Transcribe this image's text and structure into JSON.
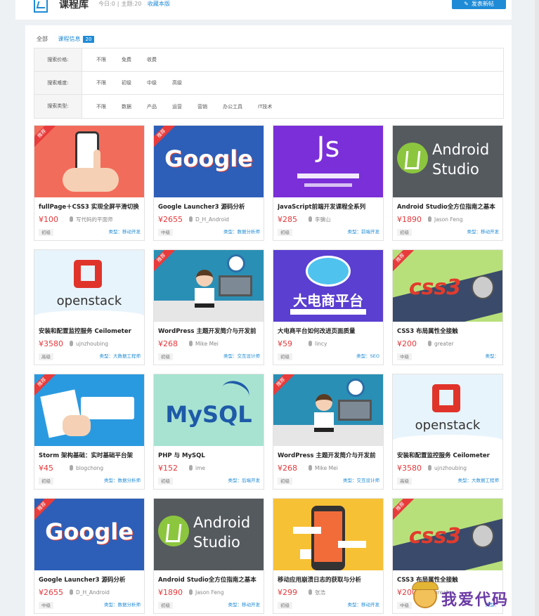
{
  "header": {
    "title": "课程库",
    "today_label": "今日:0",
    "topics_label": "主题:20",
    "bookmark": "收藏本版",
    "post_button": "发表新帖",
    "accent": "#1f8bd6"
  },
  "tabs": {
    "all": "全部",
    "course_info": "课程信息",
    "course_count": "20"
  },
  "filters": [
    {
      "label": "搜索价格:",
      "options": [
        "不限",
        "免费",
        "收费"
      ]
    },
    {
      "label": "搜索难度:",
      "options": [
        "不限",
        "初级",
        "中级",
        "高级"
      ]
    },
    {
      "label": "搜索类型:",
      "options": [
        "不限",
        "数据",
        "产品",
        "运营",
        "营销",
        "办公工具",
        "IT技术"
      ]
    }
  ],
  "cards": [
    {
      "title": "fullPage＋CSS3 实现全屏平滑切换",
      "price": "¥100",
      "author": "写代码的平面师",
      "level": "初级",
      "category": "类型：移动开发",
      "badge": "推荐",
      "thumb": "phone",
      "bg": "#f26c5b",
      "thumb_text": ""
    },
    {
      "title": "Google Launcher3 源码分析",
      "price": "¥2655",
      "author": "D_H_Android",
      "level": "中级",
      "category": "类型：数据分析师",
      "badge": "推荐",
      "thumb": "google",
      "bg": "#2d5fb8",
      "thumb_text": "Google"
    },
    {
      "title": "JavaScript前端开发课程全系列",
      "price": "¥285",
      "author": "李骥山",
      "level": "初级",
      "category": "类型：前端开发",
      "badge": "",
      "thumb": "js",
      "bg": "#7a2fd8",
      "thumb_text": "Js"
    },
    {
      "title": "Android Studio全方位指南之基本",
      "price": "¥1890",
      "author": "Jason Feng",
      "level": "初级",
      "category": "类型：移动开发",
      "badge": "",
      "thumb": "android",
      "bg": "#555a5f",
      "thumb_text": "Android Studio"
    },
    {
      "title": "安装和配置监控服务 Ceilometer",
      "price": "¥3580",
      "author": "ujnzhoubing",
      "level": "高级",
      "category": "类型：大数据工程师",
      "badge": "",
      "thumb": "openstack",
      "bg": "#e8f4fb",
      "thumb_text": "openstack"
    },
    {
      "title": "WordPress 主题开发简介与开发前",
      "price": "¥268",
      "author": "Mike Mei",
      "level": "初级",
      "category": "类型：交互设计师",
      "badge": "推荐",
      "thumb": "wordpress",
      "bg": "#2a8fb5",
      "thumb_text": ""
    },
    {
      "title": "大电商平台如何改进页面质量",
      "price": "¥59",
      "author": "lincy",
      "level": "初级",
      "category": "类型：SEO",
      "badge": "",
      "thumb": "ecommerce",
      "bg": "#5a3fd0",
      "thumb_text": "大电商平台"
    },
    {
      "title": "CSS3 布局属性全接触",
      "price": "¥200",
      "author": "greater",
      "level": "中级",
      "category": "类型：",
      "badge": "推荐",
      "thumb": "css3",
      "bg": "#b8e07a",
      "thumb_text": "css3"
    },
    {
      "title": "Storm 架构基础：实时基础平台架",
      "price": "¥45",
      "author": "blogchong",
      "level": "初级",
      "category": "类型：数据分析师",
      "badge": "推荐",
      "thumb": "desk",
      "bg": "#2a9ae0",
      "thumb_text": ""
    },
    {
      "title": "PHP 与 MySQL",
      "price": "¥152",
      "author": "ime",
      "level": "初级",
      "category": "类型：后端开发",
      "badge": "",
      "thumb": "mysql",
      "bg": "#a8e3d2",
      "thumb_text": "MySQL"
    },
    {
      "title": "WordPress 主题开发简介与开发前",
      "price": "¥268",
      "author": "Mike Mei",
      "level": "初级",
      "category": "类型：交互设计师",
      "badge": "推荐",
      "thumb": "wordpress",
      "bg": "#2a8fb5",
      "thumb_text": ""
    },
    {
      "title": "安装和配置监控服务 Ceilometer",
      "price": "¥3580",
      "author": "ujnzhoubing",
      "level": "高级",
      "category": "类型：大数据工程师",
      "badge": "",
      "thumb": "openstack",
      "bg": "#e8f4fb",
      "thumb_text": "openstack"
    },
    {
      "title": "Google Launcher3 源码分析",
      "price": "¥2655",
      "author": "D_H_Android",
      "level": "中级",
      "category": "类型：数据分析师",
      "badge": "推荐",
      "thumb": "google",
      "bg": "#2d5fb8",
      "thumb_text": "Google"
    },
    {
      "title": "Android Studio全方位指南之基本",
      "price": "¥1890",
      "author": "Jason Feng",
      "level": "初级",
      "category": "类型：移动开发",
      "badge": "",
      "thumb": "android",
      "bg": "#555a5f",
      "thumb_text": "Android Studio"
    },
    {
      "title": "移动应用崩溃日志的获取与分析",
      "price": "¥299",
      "author": "张浩",
      "level": "初级",
      "category": "类型：移动开发",
      "badge": "",
      "thumb": "mobile",
      "bg": "#f7c136",
      "thumb_text": ""
    },
    {
      "title": "CSS3 布局属性全接触",
      "price": "¥200",
      "author": "greater",
      "level": "中级",
      "category": "类型：",
      "badge": "推荐",
      "thumb": "css3",
      "bg": "#b8e07a",
      "thumb_text": "css3"
    }
  ],
  "watermark": {
    "text": "我爱代码"
  },
  "icons": {
    "post": "pen-icon",
    "author": "person-icon"
  }
}
